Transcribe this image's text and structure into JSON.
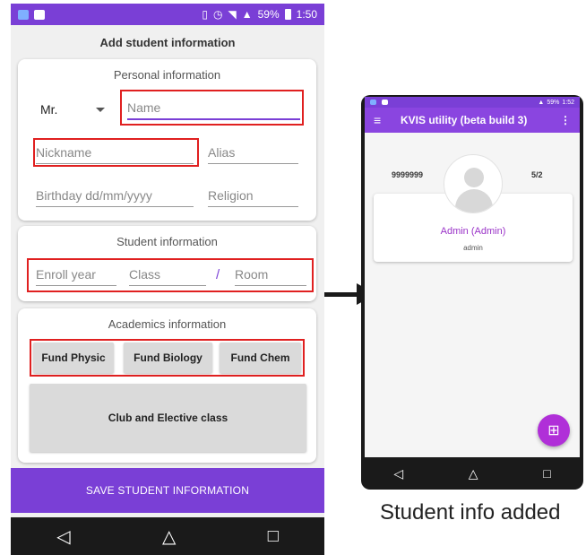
{
  "left_phone": {
    "status": {
      "battery": "59%",
      "time": "1:50"
    },
    "form_title": "Add student information",
    "personal": {
      "title": "Personal information",
      "title_value": "Mr.",
      "name_placeholder": "Name",
      "nickname_placeholder": "Nickname",
      "alias_placeholder": "Alias",
      "birthday_placeholder": "Birthday dd/mm/yyyy",
      "religion_placeholder": "Religion"
    },
    "student": {
      "title": "Student information",
      "enroll_placeholder": "Enroll year",
      "class_placeholder": "Class",
      "slash": "/",
      "room_placeholder": "Room"
    },
    "academics": {
      "title": "Academics information",
      "buttons": [
        "Fund Physic",
        "Fund Biology",
        "Fund Chem"
      ],
      "club_button": "Club and Elective class"
    },
    "save_button": "SAVE STUDENT INFORMATION",
    "nav": {
      "back": "◁",
      "home": "△",
      "recent": "□"
    }
  },
  "right_phone": {
    "status": {
      "battery": "59%",
      "time": "1:52"
    },
    "app_title": "KVIS utility (beta build 3)",
    "menu_icon": "≡",
    "more_icon": "⋮",
    "profile": {
      "id": "9999999",
      "ratio": "5/2",
      "name": "Admin (Admin)",
      "role": "admin"
    },
    "fab_icon": "⊞",
    "nav": {
      "back": "◁",
      "home": "△",
      "recent": "□"
    }
  },
  "caption": "Student info added",
  "colors": {
    "primary": "#7a3fd6",
    "accent": "#b02fd8",
    "highlight": "#e02020"
  }
}
